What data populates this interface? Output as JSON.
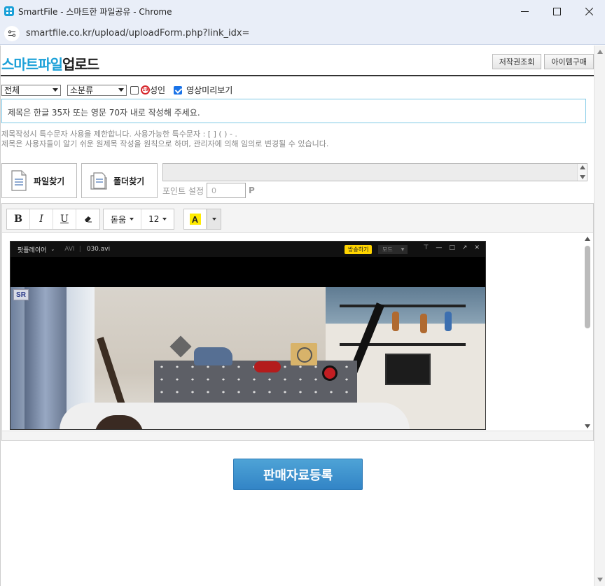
{
  "window": {
    "title": "SmartFile - 스마트한 파일공유 - Chrome",
    "url": "smartfile.co.kr/upload/uploadForm.php?link_idx="
  },
  "header": {
    "brand_part1": "스마트파일",
    "brand_part2": "업로드",
    "copyright_button": "저작권조회",
    "item_purchase_button": "아이템구매"
  },
  "filters": {
    "category_selected": "전체",
    "subcategory_selected": "소분류",
    "adult_label": "성인",
    "adult_badge": "19",
    "adult_checked": false,
    "preview_label": "영상미리보기",
    "preview_checked": true
  },
  "title_field": {
    "placeholder": "제목은 한글 35자 또는 영문 70자 내로 작성해 주세요."
  },
  "hints": {
    "line1": "제목작성시 특수문자 사용을 제한합니다. 사용가능한 특수문자 : [ ] ( ) - .",
    "line2": "제목은 사용자들이 알기 쉬운 원제목 작성을 원칙으로 하며, 관리자에 의해 임의로 변경될 수 있습니다."
  },
  "file_section": {
    "find_file_button": "파일찾기",
    "find_folder_button": "폴더찾기",
    "point_label": "포인트 설정",
    "point_value": "0",
    "point_unit": "P"
  },
  "editor_toolbar": {
    "bold": "B",
    "italic": "I",
    "underline": "U",
    "font_name": "돋움",
    "font_size": "12",
    "highlight_letter": "A"
  },
  "player": {
    "app_name": "팟플레이어",
    "format": "AVI",
    "file_name": "030.avi",
    "broadcast_button": "방송하기",
    "mode_label": "모드",
    "watermark": "SR"
  },
  "submit_button": "판매자료등록",
  "colors": {
    "brand_blue": "#1aa0d8",
    "submit_blue": "#3284c6",
    "highlight_yellow": "#ffeb00"
  }
}
